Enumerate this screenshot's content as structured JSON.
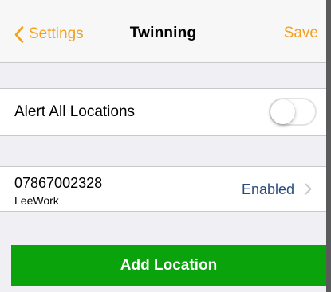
{
  "nav": {
    "back_label": "Settings",
    "title": "Twinning",
    "save_label": "Save"
  },
  "alert_all": {
    "label": "Alert All Locations",
    "enabled": false
  },
  "location": {
    "number": "07867002328",
    "name": "LeeWork",
    "status": "Enabled"
  },
  "add_button": {
    "label": "Add Location"
  },
  "colors": {
    "accent": "#f2a11c",
    "button_green": "#0ba30b",
    "status_blue": "#2a4c7d",
    "background": "#efeff4"
  }
}
